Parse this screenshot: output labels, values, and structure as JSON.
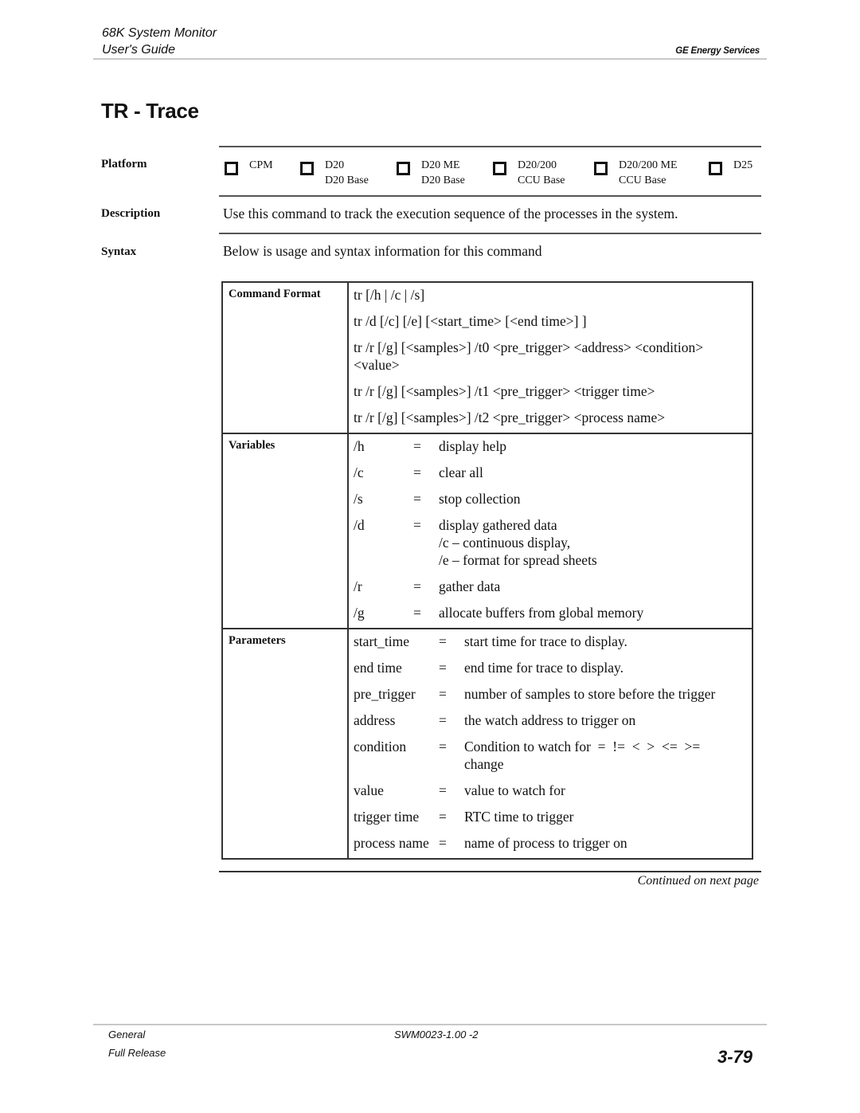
{
  "header": {
    "title": "68K System Monitor",
    "subtitle": "User's Guide",
    "company": "GE Energy Services"
  },
  "page_title": "TR - Trace",
  "sections": {
    "platform_label": "Platform",
    "description_label": "Description",
    "syntax_label": "Syntax"
  },
  "platforms": [
    {
      "line1": "CPM",
      "line2": "",
      "checked": false
    },
    {
      "line1": "D20",
      "line2": "D20 Base",
      "checked": false
    },
    {
      "line1": "D20 ME",
      "line2": "D20 Base",
      "checked": false
    },
    {
      "line1": "D20/200",
      "line2": "CCU Base",
      "checked": false
    },
    {
      "line1": "D20/200 ME",
      "line2": "CCU Base",
      "checked": false
    },
    {
      "line1": "D25",
      "line2": "",
      "checked": false
    }
  ],
  "description": "Use this command to track the execution sequence of the processes in the system.",
  "syntax_intro": "Below is usage and syntax information for this command",
  "table": {
    "command_format": {
      "label": "Command Format",
      "lines": [
        "tr [/h | /c | /s]",
        "tr /d [/c] [/e] [<start_time> [<end time>] ]",
        "tr /r [/g] [<samples>] /t0 <pre_trigger> <address> <condition> <value>",
        "tr /r [/g] [<samples>] /t1 <pre_trigger> <trigger time>",
        "tr /r [/g] [<samples>] /t2 <pre_trigger> <process name>"
      ]
    },
    "variables": {
      "label": "Variables",
      "rows": [
        {
          "key": "/h",
          "eq": "=",
          "desc": "display help",
          "sub": []
        },
        {
          "key": "/c",
          "eq": "=",
          "desc": "clear all",
          "sub": []
        },
        {
          "key": "/s",
          "eq": "=",
          "desc": "stop collection",
          "sub": []
        },
        {
          "key": "/d",
          "eq": "=",
          "desc": "display gathered data",
          "sub": [
            "/c – continuous display,",
            "/e – format for spread sheets"
          ]
        },
        {
          "key": "/r",
          "eq": "=",
          "desc": "gather data",
          "sub": []
        },
        {
          "key": "/g",
          "eq": "=",
          "desc": "allocate buffers from global memory",
          "sub": []
        }
      ]
    },
    "parameters": {
      "label": "Parameters",
      "rows": [
        {
          "key": "start_time",
          "eq": "=",
          "desc": "start time for trace to display."
        },
        {
          "key": "end time",
          "eq": "=",
          "desc": "end time for trace to display."
        },
        {
          "key": "pre_trigger",
          "eq": "=",
          "desc": "number of samples to store before the trigger"
        },
        {
          "key": "address",
          "eq": "=",
          "desc": "the watch  address to trigger on"
        },
        {
          "key": "condition",
          "eq": "=",
          "desc": "Condition to watch for  =  !=  <  >  <=  >= change"
        },
        {
          "key": "value",
          "eq": "=",
          "desc": "value to watch for"
        },
        {
          "key": "trigger time",
          "eq": "=",
          "desc": "RTC time to trigger"
        },
        {
          "key": "process name",
          "eq": "=",
          "desc": "name of process to trigger on"
        }
      ]
    }
  },
  "continued": "Continued on next page",
  "footer": {
    "section": "General",
    "release": "Full Release",
    "doc_id": "SWM0023-1.00 -2",
    "page_number": "3-79"
  }
}
